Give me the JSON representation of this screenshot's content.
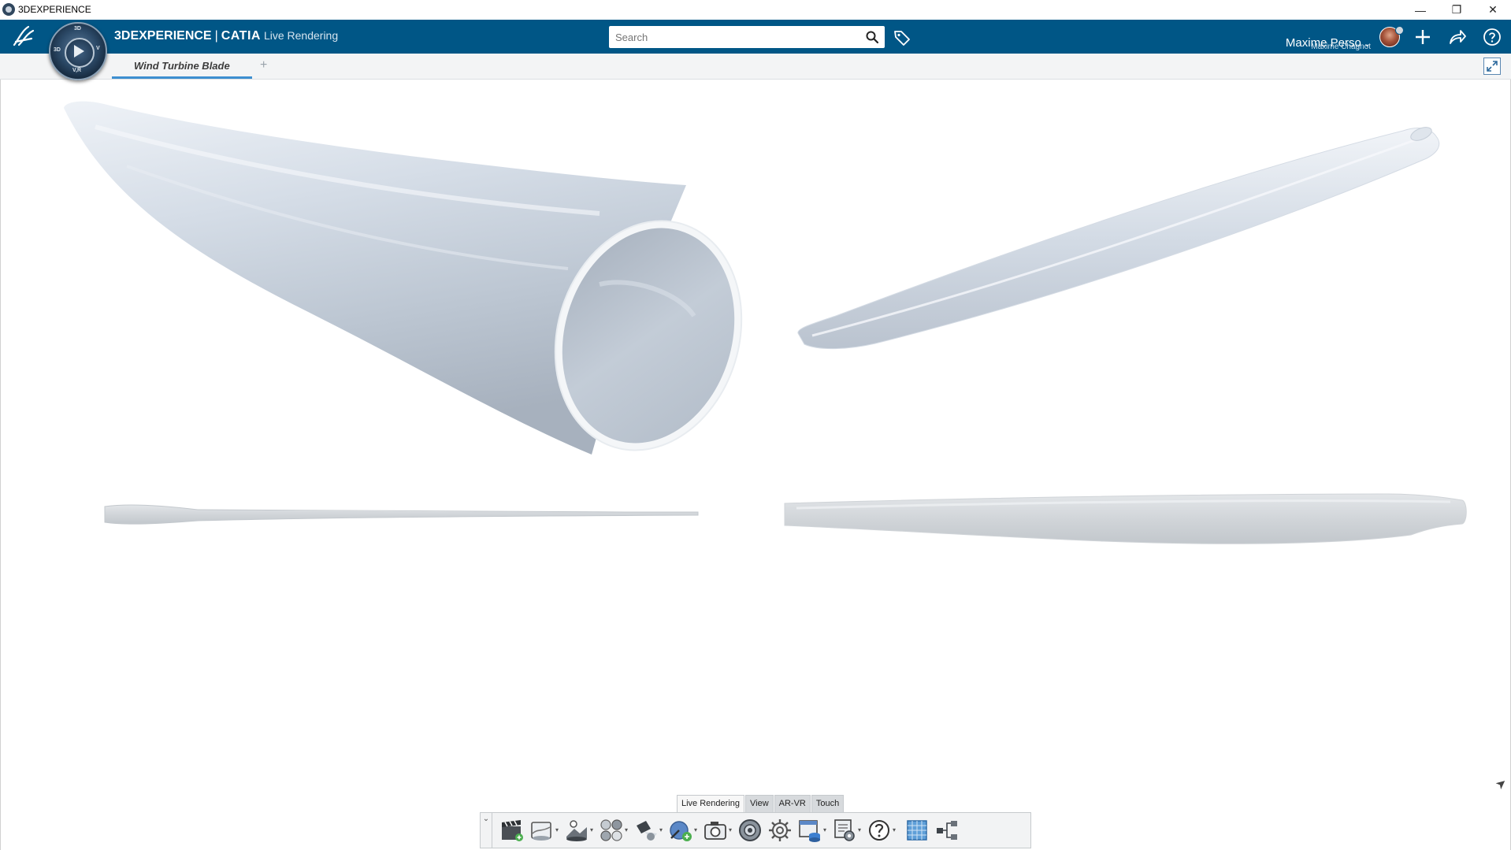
{
  "window": {
    "title": "3DEXPERIENCE",
    "controls": {
      "minimize": "—",
      "restore": "❐",
      "close": "✕"
    }
  },
  "topbar": {
    "brand_prefix": "3DEXPERIENCE",
    "brand_separator": "|",
    "brand_app": "CATIA",
    "brand_role": "Live Rendering",
    "search": {
      "placeholder": "Search",
      "value": ""
    },
    "user": {
      "account": "Maxime Chagnot",
      "display_name": "Maxime Perso"
    },
    "compass_labels": {
      "top": "3D",
      "left": "3D",
      "right": "V",
      "bottom": "V,R"
    },
    "icons": [
      "ds-logo-icon",
      "compass-icon",
      "search-icon",
      "tag-icon",
      "avatar",
      "plus-icon",
      "share-icon",
      "help-icon"
    ]
  },
  "tabs": {
    "items": [
      {
        "label": "Wind Turbine Blade",
        "active": true
      }
    ],
    "add_label": "+"
  },
  "viewport": {
    "model": "Wind Turbine Blade",
    "views": [
      "root-end perspective view",
      "oblique view",
      "edge view",
      "planform view"
    ]
  },
  "action_bar": {
    "section_tabs": [
      {
        "label": "Live Rendering",
        "active": true
      },
      {
        "label": "View",
        "active": false
      },
      {
        "label": "AR-VR",
        "active": false
      },
      {
        "label": "Touch",
        "active": false
      }
    ],
    "collapse_glyph": "⌄",
    "commands": [
      "clapperboard-icon",
      "environment-icon",
      "stage-icon",
      "materials-icon",
      "lights-icon",
      "camera-add-icon",
      "capture-icon",
      "render-icon",
      "settings-icon",
      "data-icon",
      "tools-icon",
      "help-icon",
      "grid-icon",
      "tree-icon"
    ]
  },
  "colors": {
    "topbar": "#005686",
    "tab_underline": "#3d8fd0",
    "blade_light": "#eef2f6",
    "blade_mid": "#c9d2dd",
    "blade_dark": "#a9b2bf"
  }
}
